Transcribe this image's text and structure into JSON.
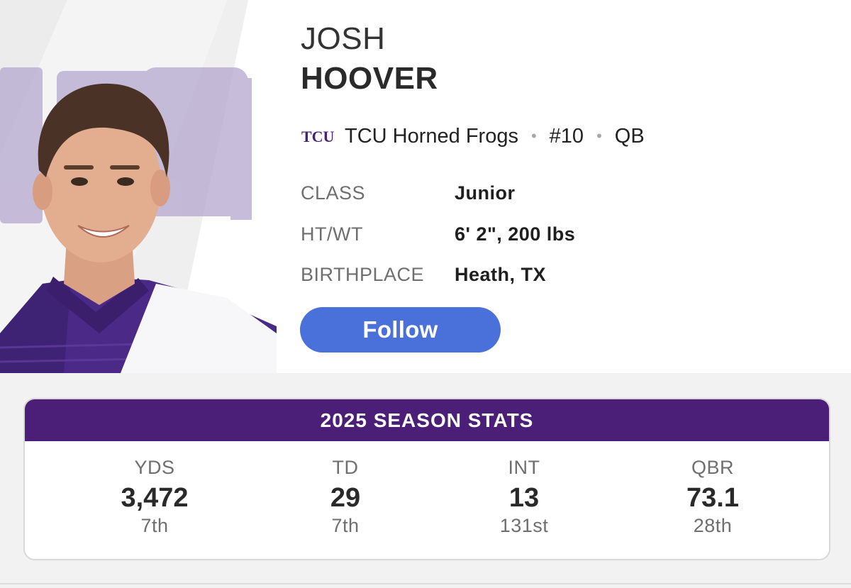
{
  "player": {
    "first_name": "JOSH",
    "last_name": "HOOVER"
  },
  "team": {
    "logo_text": "TCU",
    "name": "TCU Horned Frogs",
    "number": "#10",
    "position": "QB",
    "separator": "•",
    "brand_color": "#4b1f77"
  },
  "info": [
    {
      "label": "CLASS",
      "value": "Junior"
    },
    {
      "label": "HT/WT",
      "value": "6' 2\", 200 lbs"
    },
    {
      "label": "BIRTHPLACE",
      "value": "Heath, TX"
    }
  ],
  "follow_button": {
    "label": "Follow",
    "color": "#4a70d9"
  },
  "season_stats": {
    "title": "2025 SEASON STATS",
    "stats": [
      {
        "label": "YDS",
        "value": "3,472",
        "rank": "7th"
      },
      {
        "label": "TD",
        "value": "29",
        "rank": "7th"
      },
      {
        "label": "INT",
        "value": "13",
        "rank": "131st"
      },
      {
        "label": "QBR",
        "value": "73.1",
        "rank": "28th"
      }
    ]
  }
}
